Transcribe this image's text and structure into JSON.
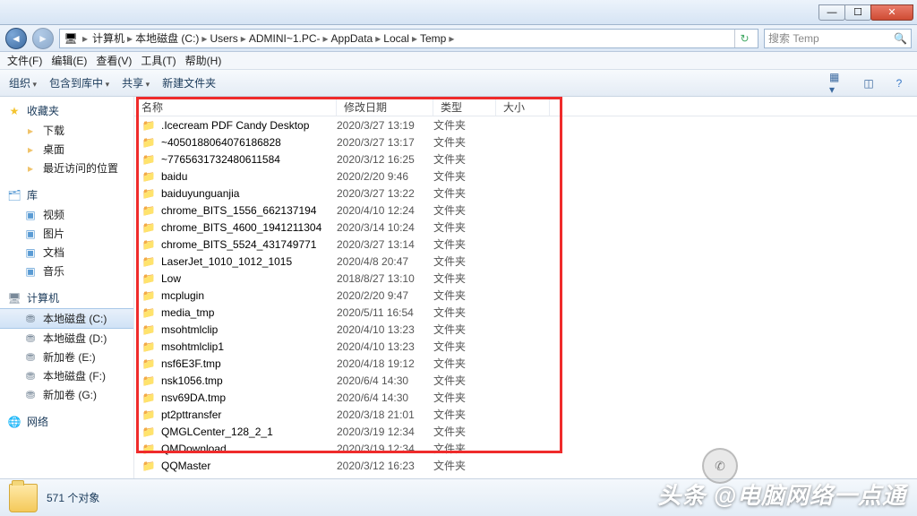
{
  "window": {
    "minimize": "—",
    "maximize": "☐",
    "close": "✕"
  },
  "breadcrumb": {
    "segs": [
      "计算机",
      "本地磁盘 (C:)",
      "Users",
      "ADMINI~1.PC-",
      "AppData",
      "Local",
      "Temp"
    ],
    "search_placeholder": "搜索 Temp"
  },
  "menubar": [
    "文件(F)",
    "编辑(E)",
    "查看(V)",
    "工具(T)",
    "帮助(H)"
  ],
  "toolbar": {
    "organize": "组织",
    "include": "包含到库中",
    "share": "共享",
    "newfolder": "新建文件夹"
  },
  "sidebar": {
    "favorites": {
      "label": "收藏夹",
      "items": [
        "下载",
        "桌面",
        "最近访问的位置"
      ]
    },
    "libraries": {
      "label": "库",
      "items": [
        "视频",
        "图片",
        "文档",
        "音乐"
      ]
    },
    "computer": {
      "label": "计算机",
      "items": [
        "本地磁盘 (C:)",
        "本地磁盘 (D:)",
        "新加卷 (E:)",
        "本地磁盘 (F:)",
        "新加卷 (G:)"
      ]
    },
    "network": {
      "label": "网络"
    }
  },
  "columns": {
    "name": "名称",
    "date": "修改日期",
    "type": "类型",
    "size": "大小"
  },
  "folder_type": "文件夹",
  "files": [
    {
      "name": ".Icecream PDF Candy Desktop",
      "date": "2020/3/27 13:19"
    },
    {
      "name": "~4050188064076186828",
      "date": "2020/3/27 13:17"
    },
    {
      "name": "~7765631732480611584",
      "date": "2020/3/12 16:25"
    },
    {
      "name": "baidu",
      "date": "2020/2/20 9:46"
    },
    {
      "name": "baiduyunguanjia",
      "date": "2020/3/27 13:22"
    },
    {
      "name": "chrome_BITS_1556_662137194",
      "date": "2020/4/10 12:24"
    },
    {
      "name": "chrome_BITS_4600_1941211304",
      "date": "2020/3/14 10:24"
    },
    {
      "name": "chrome_BITS_5524_431749771",
      "date": "2020/3/27 13:14"
    },
    {
      "name": "LaserJet_1010_1012_1015",
      "date": "2020/4/8 20:47"
    },
    {
      "name": "Low",
      "date": "2018/8/27 13:10"
    },
    {
      "name": "mcplugin",
      "date": "2020/2/20 9:47"
    },
    {
      "name": "media_tmp",
      "date": "2020/5/11 16:54"
    },
    {
      "name": "msohtmlclip",
      "date": "2020/4/10 13:23"
    },
    {
      "name": "msohtmlclip1",
      "date": "2020/4/10 13:23"
    },
    {
      "name": "nsf6E3F.tmp",
      "date": "2020/4/18 19:12"
    },
    {
      "name": "nsk1056.tmp",
      "date": "2020/6/4 14:30"
    },
    {
      "name": "nsv69DA.tmp",
      "date": "2020/6/4 14:30"
    },
    {
      "name": "pt2pttransfer",
      "date": "2020/3/18 21:01"
    },
    {
      "name": "QMGLCenter_128_2_1",
      "date": "2020/3/19 12:34"
    },
    {
      "name": "QMDownload",
      "date": "2020/3/19 12:34"
    },
    {
      "name": "QQMaster",
      "date": "2020/3/12 16:23"
    }
  ],
  "status": {
    "count": "571 个对象"
  },
  "watermark": "头条 @电脑网络一点通"
}
